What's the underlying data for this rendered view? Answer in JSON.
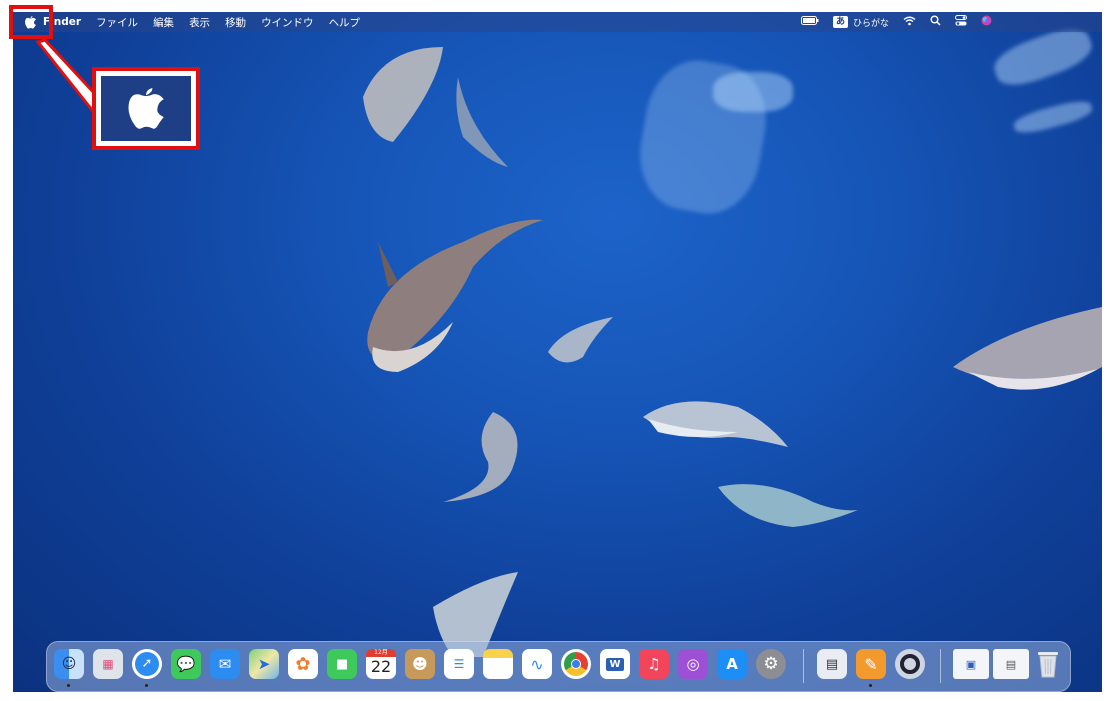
{
  "menubar": {
    "apple_icon": "apple-logo-icon",
    "app_name": "Finder",
    "menus": [
      "ファイル",
      "編集",
      "表示",
      "移動",
      "ウインドウ",
      "ヘルプ"
    ],
    "input_mode_glyph": "あ",
    "input_mode_label": "ひらがな"
  },
  "dock": {
    "calendar_month": "12月",
    "calendar_day": "22",
    "apps": [
      "finder-icon",
      "launchpad-icon",
      "safari-icon",
      "messages-icon",
      "mail-icon",
      "maps-icon",
      "photos-icon",
      "facetime-icon",
      "calendar-icon",
      "contacts-icon",
      "reminders-icon",
      "notes-icon",
      "freeform-icon",
      "chrome-icon",
      "word-icon",
      "music-icon",
      "podcasts-icon",
      "app-store-icon",
      "system-settings-icon",
      "preview-icon",
      "pages-icon",
      "quicktime-icon",
      "recent-document-icon",
      "recent-image-icon",
      "trash-icon"
    ]
  },
  "callout": {
    "target": "apple-logo-icon",
    "color": "#e01010"
  },
  "colors": {
    "accent_red": "#e01010",
    "ocean_blue": "#1656b8"
  }
}
